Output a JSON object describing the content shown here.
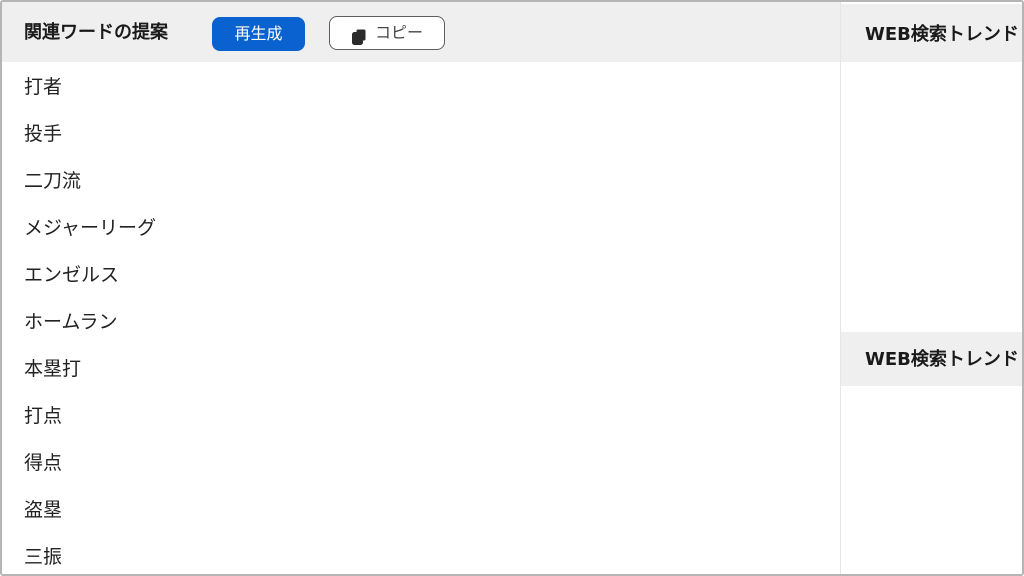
{
  "related_words": {
    "title": "関連ワードの提案",
    "regenerate_label": "再生成",
    "copy_label": "コピー",
    "copy_icon": "copy-icon",
    "items": [
      "打者",
      "投手",
      "二刀流",
      "メジャーリーグ",
      "エンゼルス",
      "ホームラン",
      "本塁打",
      "打点",
      "得点",
      "盗塁",
      "三振"
    ]
  },
  "web_trends": {
    "section1_title": "WEB検索トレンド",
    "section2_title": "WEB検索トレンド"
  },
  "colors": {
    "accent": "#0a62d0",
    "header_bg": "#efefef",
    "border": "#b5b5b5"
  }
}
